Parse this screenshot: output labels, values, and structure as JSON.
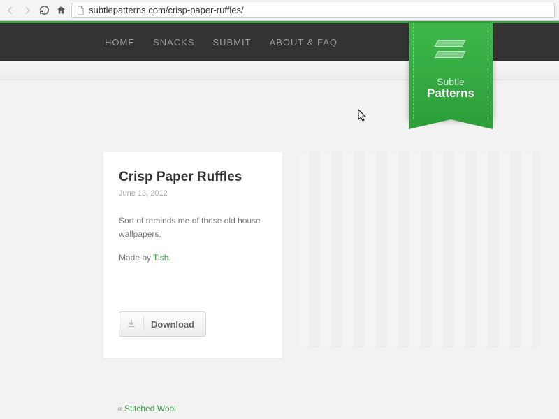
{
  "browser": {
    "url": "subtlepatterns.com/crisp-paper-ruffles/"
  },
  "nav": {
    "items": [
      "HOME",
      "SNACKS",
      "SUBMIT",
      "ABOUT & FAQ"
    ]
  },
  "ribbon": {
    "line1": "Subtle",
    "line2": "Patterns"
  },
  "post": {
    "title": "Crisp Paper Ruffles",
    "date": "June 13, 2012",
    "description": "Sort of reminds me of those old house wallpapers.",
    "made_by_prefix": "Made by ",
    "made_by_name": "Tish",
    "made_by_suffix": ".",
    "download_label": "Download"
  },
  "prev": {
    "marker": "« ",
    "label": "Stitched Wool"
  }
}
